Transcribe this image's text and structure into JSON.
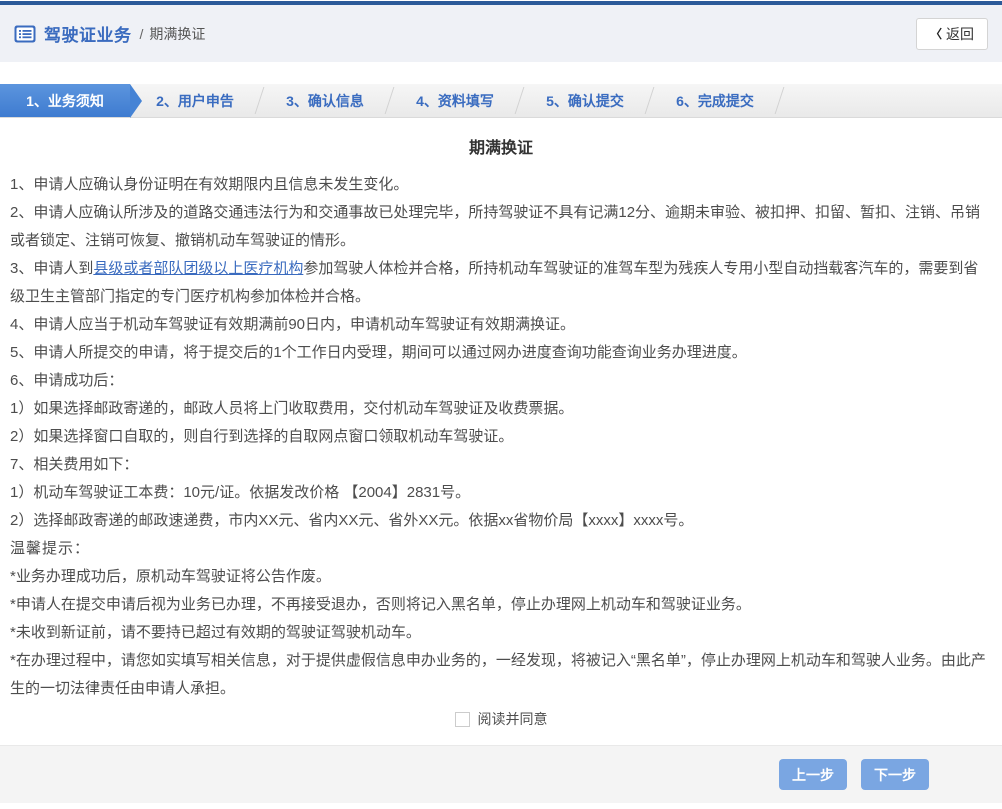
{
  "header": {
    "title": "驾驶证业务",
    "separator": "/",
    "subtitle": "期满换证",
    "back_chevron": "〈",
    "back_label": "返回"
  },
  "steps": [
    {
      "label": "1、业务须知",
      "active": true
    },
    {
      "label": "2、用户申告",
      "active": false
    },
    {
      "label": "3、确认信息",
      "active": false
    },
    {
      "label": "4、资料填写",
      "active": false
    },
    {
      "label": "5、确认提交",
      "active": false
    },
    {
      "label": "6、完成提交",
      "active": false
    }
  ],
  "content": {
    "title": "期满换证",
    "notices": [
      "1、申请人应确认身份证明在有效期限内且信息未发生变化。",
      "2、申请人应确认所涉及的道路交通违法行为和交通事故已处理完毕，所持驾驶证不具有记满12分、逾期未审验、被扣押、扣留、暂扣、注销、吊销或者锁定、注销可恢复、撤销机动车驾驶证的情形。"
    ],
    "notice3": {
      "pre": "3、申请人到",
      "link": "县级或者部队团级以上医疗机构",
      "post": "参加驾驶人体检并合格，所持机动车驾驶证的准驾车型为残疾人专用小型自动挡载客汽车的，需要到省级卫生主管部门指定的专门医疗机构参加体检并合格。"
    },
    "notices2": [
      "4、申请人应当于机动车驾驶证有效期满前90日内，申请机动车驾驶证有效期满换证。",
      "5、申请人所提交的申请，将于提交后的1个工作日内受理，期间可以通过网办进度查询功能查询业务办理进度。",
      "6、申请成功后：",
      "1）如果选择邮政寄递的，邮政人员将上门收取费用，交付机动车驾驶证及收费票据。",
      "2）如果选择窗口自取的，则自行到选择的自取网点窗口领取机动车驾驶证。",
      "7、相关费用如下：",
      "1）机动车驾驶证工本费：10元/证。依据发改价格 【2004】2831号。",
      "2）选择邮政寄递的邮政速递费，市内XX元、省内XX元、省外XX元。依据xx省物价局【xxxx】xxxx号。"
    ],
    "tips_title": "温馨提示：",
    "tips": [
      "*业务办理成功后，原机动车驾驶证将公告作废。",
      "*申请人在提交申请后视为业务已办理，不再接受退办，否则将记入黑名单，停止办理网上机动车和驾驶证业务。",
      "*未收到新证前，请不要持已超过有效期的驾驶证驾驶机动车。",
      "*在办理过程中，请您如实填写相关信息，对于提供虚假信息申办业务的，一经发现，将被记入“黑名单”，停止办理网上机动车和驾驶人业务。由此产生的一切法律责任由申请人承担。"
    ],
    "agree_label": "阅读并同意"
  },
  "footer": {
    "prev_label": "上一步",
    "next_label": "下一步"
  },
  "colors": {
    "top_strip": "#2b5a99",
    "header_bg": "#eff1f6",
    "active_tab_blue": "#4a86d8",
    "tab_text_blue": "#3a6cc0",
    "link_blue": "#3a6bbf",
    "button_blue": "#7aa6e2",
    "footer_bg": "#f4f4f4",
    "body_text": "#4d4d4d"
  }
}
